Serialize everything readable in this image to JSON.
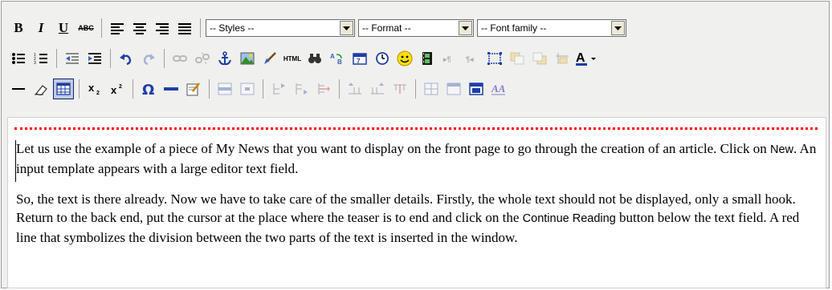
{
  "toolbar": {
    "styles_value": "-- Styles --",
    "format_value": "-- Format --",
    "font_family_value": "-- Font family --",
    "bold_label": "B",
    "italic_label": "I",
    "underline_label": "U",
    "strike_label": "ABC",
    "html_label": "HTML"
  },
  "content": {
    "paragraphs": [
      {
        "part1": "Let us use the example of a piece of My News that you want to display on the front page to go through the creation of an article. Click on ",
        "code1": "New",
        "part2": ". An input template appears with a large editor text field."
      },
      {
        "part1": "So, the text is there already. Now we have to take care of the smaller details. Firstly, the whole text should not be displayed, only a small hook. Return to the back end, put the cursor at the place where the teaser is to end and click on the ",
        "code1": "Continue Reading",
        "part2": " button below the text field. A red line that symbolizes the division between the two parts of the text is inserted in the window."
      }
    ]
  }
}
